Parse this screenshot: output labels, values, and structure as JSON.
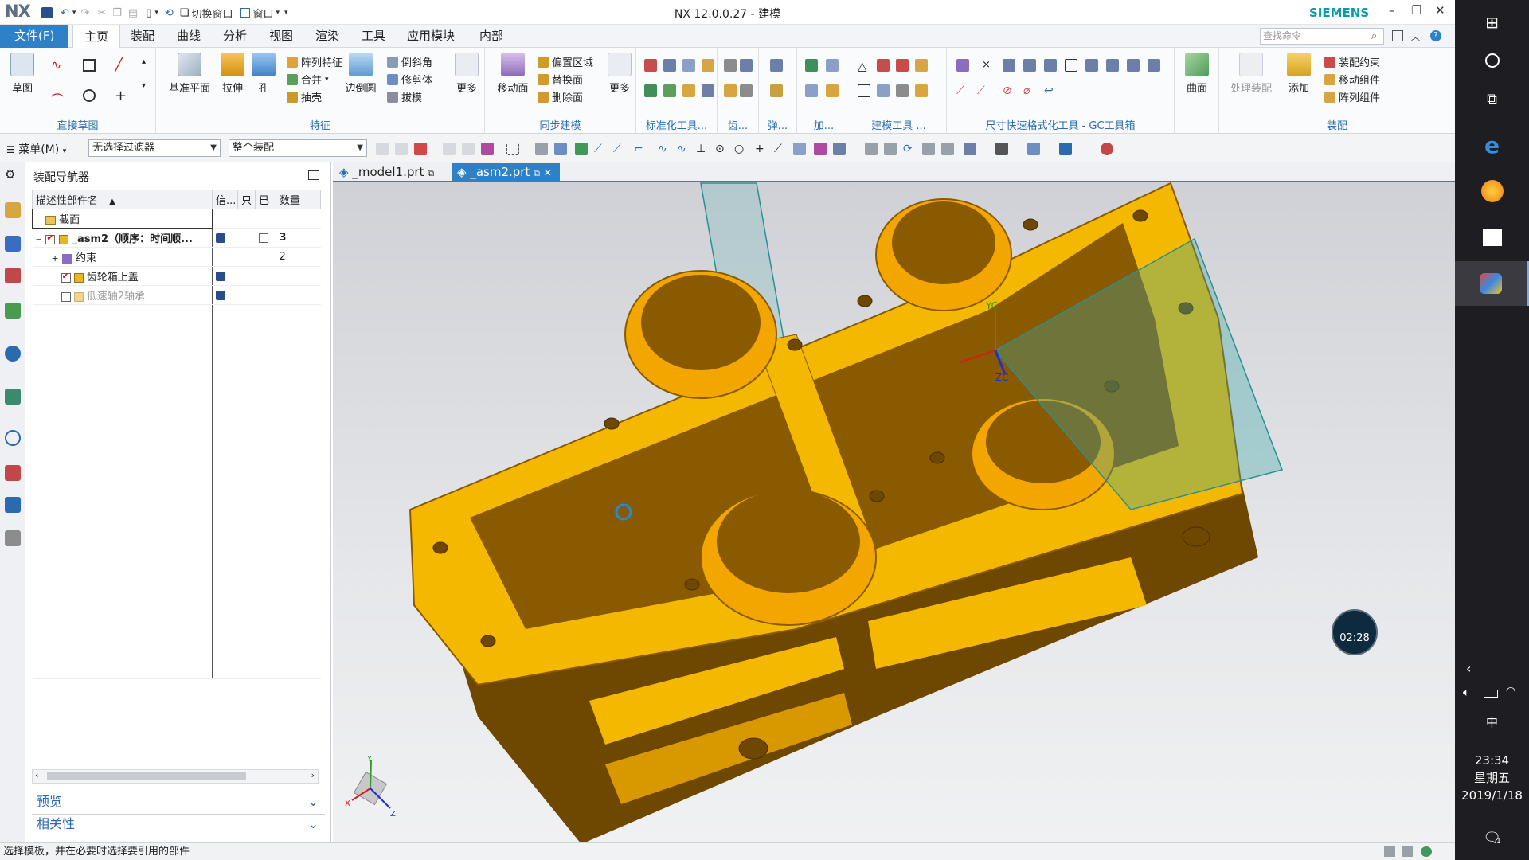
{
  "app": {
    "logo": "NX",
    "title": "NX 12.0.0.27 - 建模",
    "brand": "SIEMENS",
    "quick_access": {
      "switch_window": "切换窗口",
      "window": "窗口"
    }
  },
  "ribbon_tabs": {
    "file": "文件(F)",
    "items": [
      "主页",
      "装配",
      "曲线",
      "分析",
      "视图",
      "渲染",
      "工具",
      "应用模块",
      "内部"
    ],
    "active": "主页",
    "search_placeholder": "查找命令"
  },
  "ribbon": {
    "sketch_group": {
      "sketch": "草图",
      "label": "直接草图"
    },
    "feature_group": {
      "datum_plane": "基准平面",
      "extrude": "拉伸",
      "hole": "孔",
      "pattern_feature": "阵列特征",
      "unite": "合并",
      "shell": "抽壳",
      "edge_blend": "边倒圆",
      "chamfer": "倒斜角",
      "trim_body": "修剪体",
      "draft": "拔模",
      "more": "更多",
      "label": "特征"
    },
    "sync_group": {
      "move_face": "移动面",
      "offset_region": "偏置区域",
      "replace_face": "替换面",
      "delete_face": "删除面",
      "more": "更多",
      "label": "同步建模"
    },
    "small_groups": [
      "标准化工具...",
      "齿...",
      "弹...",
      "加...",
      "建模工具 ...",
      "尺寸快速格式化工具 - GC工具箱"
    ],
    "surface_group": {
      "surface": "曲面"
    },
    "assembly_group": {
      "process_assembly": "处理装配",
      "add": "添加",
      "assembly_constraints": "装配约束",
      "move_component": "移动组件",
      "pattern_component": "阵列组件",
      "label": "装配"
    }
  },
  "selection_bar": {
    "menu": "菜单(M)",
    "filter": "无选择过滤器",
    "scope": "整个装配"
  },
  "navigator": {
    "title": "装配导航器",
    "columns": [
      "描述性部件名",
      "信...",
      "只",
      "已",
      "数量"
    ],
    "rows": [
      {
        "name": "截面",
        "qty": ""
      },
      {
        "name": "_asm2（顺序：时间顺...",
        "qty": "3"
      },
      {
        "name": "约束",
        "qty": "2"
      },
      {
        "name": "齿轮箱上盖",
        "qty": ""
      },
      {
        "name": "低速轴2轴承",
        "qty": ""
      }
    ],
    "panels": [
      "预览",
      "相关性"
    ]
  },
  "doc_tabs": [
    "_model1.prt",
    "_asm2.prt"
  ],
  "viewport": {
    "csys": {
      "x": "X",
      "y": "Y",
      "z": "Z",
      "xc": "XC",
      "yc": "YC",
      "zc": "ZC"
    },
    "timer": "02:28"
  },
  "status_bar": {
    "message": "选择模板，并在必要时选择要引用的部件"
  },
  "taskbar": {
    "ime": "中",
    "time": "23:34",
    "weekday": "星期五",
    "date": "2019/1/18",
    "notification_count": "1"
  },
  "colors": {
    "accent": "#2f81c7",
    "part_yellow": "#f5b800",
    "part_brown": "#8a5a00",
    "section_plane": "#3aa6a6",
    "brand": "#0d9aa8"
  }
}
